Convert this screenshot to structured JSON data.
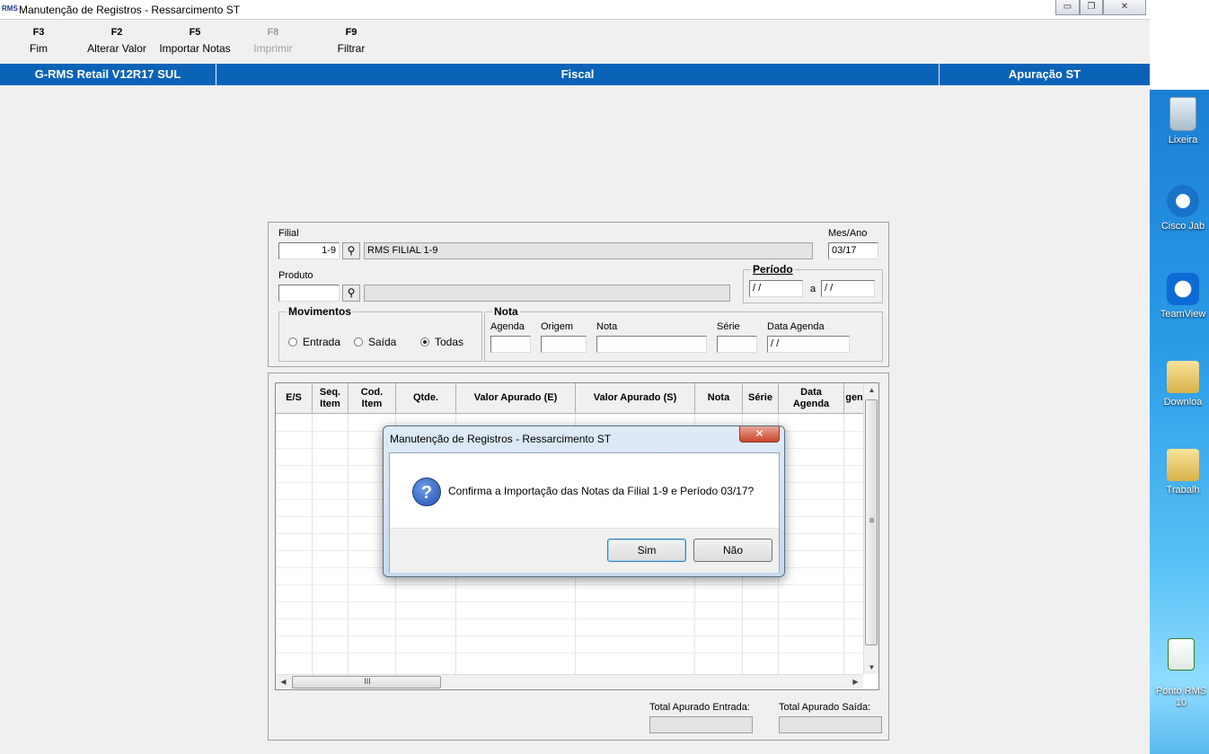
{
  "window": {
    "title": "Manutenção de Registros - Ressarcimento ST",
    "app_icon_text": "RMS"
  },
  "toolbar": [
    {
      "key": "F3",
      "label": "Fim",
      "enabled": true
    },
    {
      "key": "F2",
      "label": "Alterar Valor",
      "enabled": true
    },
    {
      "key": "F5",
      "label": "Importar Notas",
      "enabled": true
    },
    {
      "key": "F8",
      "label": "Imprimir",
      "enabled": false
    },
    {
      "key": "F9",
      "label": "Filtrar",
      "enabled": true
    }
  ],
  "header_bar": {
    "system": "G-RMS Retail V12R17 SUL",
    "module": "Fiscal",
    "screen": "Apuração ST"
  },
  "form": {
    "filial_label": "Filial",
    "filial_value": "1-9",
    "filial_name": "RMS FILIAL 1-9",
    "mes_ano_label": "Mes/Ano",
    "mes_ano_value": "03/17",
    "produto_label": "Produto",
    "produto_value": "",
    "periodo_title": "Período",
    "periodo_from": " / /",
    "periodo_sep": "a",
    "periodo_to": " / /",
    "movimentos_title": "Movimentos",
    "movimentos_options": [
      "Entrada",
      "Saída",
      "Todas"
    ],
    "movimentos_selected": "Todas",
    "nota_title": "Nota",
    "nota_fields": {
      "agenda_label": "Agenda",
      "origem_label": "Origem",
      "nota_label": "Nota",
      "serie_label": "Série",
      "data_agenda_label": "Data Agenda",
      "data_agenda_value": " / /"
    }
  },
  "grid": {
    "columns": [
      "E/S",
      "Seq.\nItem",
      "Cod.\nItem",
      "Qtde.",
      "Valor Apurado (E)",
      "Valor Apurado (S)",
      "Nota",
      "Série",
      "Data\nAgenda",
      "gen"
    ],
    "hscroll_grip": "III",
    "vscroll_grip": "≡"
  },
  "totals": {
    "entrada_label": "Total Apurado Entrada:",
    "entrada_value": "",
    "saida_label": "Total Apurado Saída:",
    "saida_value": ""
  },
  "dialog": {
    "title": "Manutenção de Registros - Ressarcimento ST",
    "message": "Confirma a Importação das Notas da Filial 1-9 e Período 03/17?",
    "yes_label": "Sim",
    "no_label": "Não",
    "icon": "question-icon"
  },
  "desktop_icons": [
    {
      "label": "Lixeira",
      "icon": "recycle-bin-icon"
    },
    {
      "label": "Cisco Jab",
      "icon": "cisco-jabber-icon"
    },
    {
      "label": "TeamView",
      "icon": "teamviewer-icon"
    },
    {
      "label": "Downloa",
      "icon": "downloads-folder-icon"
    },
    {
      "label": "Trabalh",
      "icon": "work-folder-icon"
    },
    {
      "label": "Ponto RMS\n10",
      "icon": "excel-file-icon"
    }
  ]
}
